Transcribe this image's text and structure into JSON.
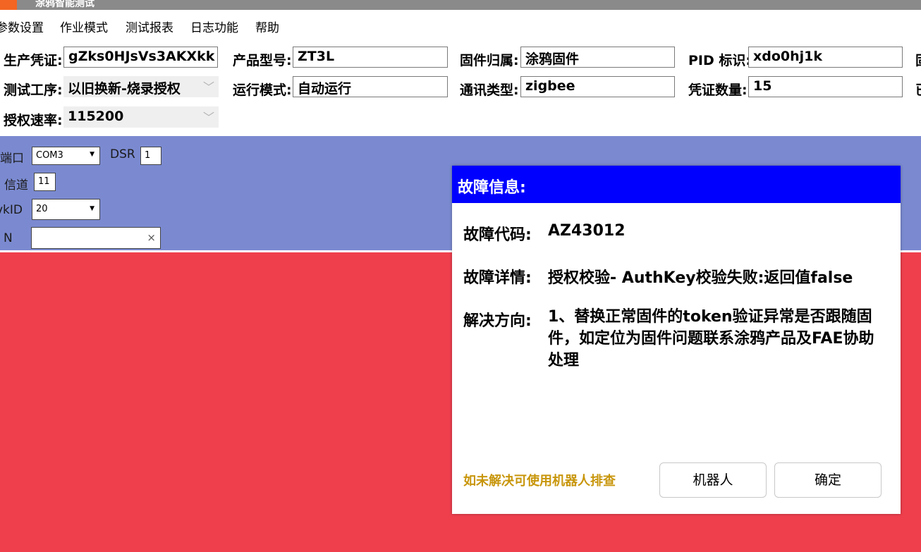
{
  "window": {
    "title": "涂鸦智能测试"
  },
  "menu": {
    "items": [
      {
        "label": "参数设置"
      },
      {
        "label": "作业模式"
      },
      {
        "label": "测试报表"
      },
      {
        "label": "日志功能"
      },
      {
        "label": "帮助"
      }
    ]
  },
  "form": {
    "production_credential": {
      "label": "生产凭证:",
      "value": "gZks0HJsVs3AKXkk"
    },
    "product_model": {
      "label": "产品型号:",
      "value": "ZT3L"
    },
    "firmware_owner": {
      "label": "固件归属:",
      "value": "涂鸦固件"
    },
    "pid": {
      "label": "PID 标识:",
      "value": "xdo0hj1k"
    },
    "test_process": {
      "label": "测试工序:",
      "value": "以旧换新-烧录授权"
    },
    "run_mode": {
      "label": "运行模式:",
      "value": "自动运行"
    },
    "comm_type": {
      "label": "通讯类型:",
      "value": "zigbee"
    },
    "credential_count": {
      "label": "凭证数量:",
      "value": "15"
    },
    "auth_rate": {
      "label": "授权速率:",
      "value": "115200"
    },
    "cut_label_1": "固",
    "cut_label_2": "已"
  },
  "serial_panel": {
    "port": {
      "label": "端口",
      "value": "COM3"
    },
    "dsr": {
      "label": "DSR",
      "value": "1"
    },
    "channel": {
      "label": "信道",
      "value": "11"
    },
    "vkid": {
      "label": "vkID",
      "value": "20"
    },
    "sn": {
      "label": "N",
      "value": ""
    }
  },
  "dialog": {
    "title": "故障信息:",
    "code_label": "故障代码:",
    "code_value": "AZ43012",
    "detail_label": "故障详情:",
    "detail_value": "授权校验- AuthKey校验失败:返回值false",
    "solution_label": "解决方向:",
    "solution_value": "1、替换正常固件的token验证异常是否跟随固件，如定位为固件问题联系涂鸦产品及FAE协助处理",
    "hint": "如未解决可使用机器人排查",
    "robot_button": "机器人",
    "ok_button": "确定"
  },
  "colors": {
    "status_fail": "#ef3f4d",
    "serial_panel_bg": "#7b8ad0",
    "dialog_header": "#0000ff",
    "hint_text": "#c8960c",
    "logo": "#f26522"
  },
  "icons": {
    "dropdown": "chevron-down-icon",
    "clear": "close-icon",
    "app_logo": "app-logo-icon"
  }
}
